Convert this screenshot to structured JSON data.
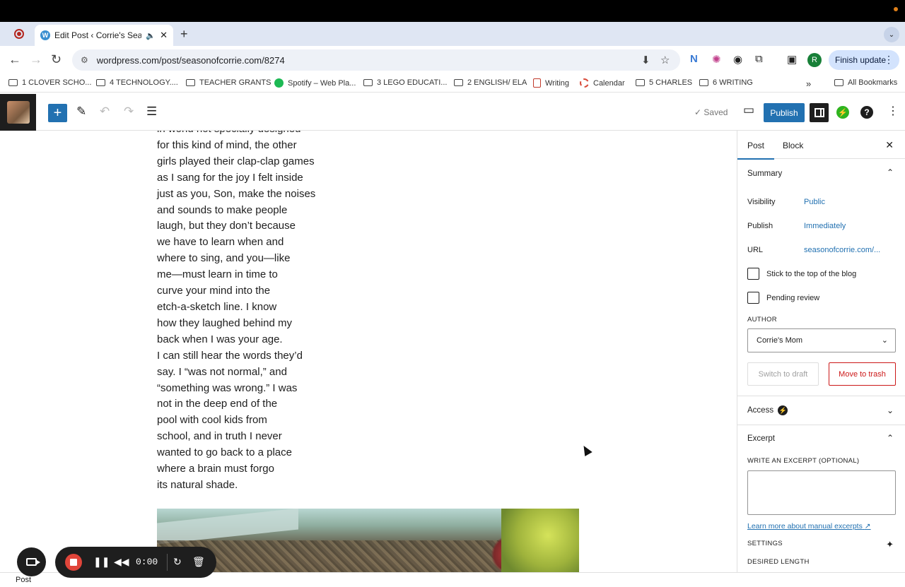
{
  "browser": {
    "tab_title": "Edit Post ‹ Corrie's Seaso",
    "url": "wordpress.com/post/seasonofcorrie.com/8274",
    "finish_update": "Finish update",
    "profile_initial": "R"
  },
  "bookmarks": [
    {
      "label": "1 CLOVER SCHO...",
      "icon": "folder-icon"
    },
    {
      "label": "4 TECHNOLOGY....",
      "icon": "folder-icon"
    },
    {
      "label": "TEACHER GRANTS",
      "icon": "folder-icon"
    },
    {
      "label": "Spotify – Web Pla...",
      "icon": "spotify-icon"
    },
    {
      "label": "3 LEGO EDUCATI...",
      "icon": "folder-icon"
    },
    {
      "label": "2 ENGLISH/ ELA",
      "icon": "folder-icon"
    },
    {
      "label": "Writing",
      "icon": "writing-icon"
    },
    {
      "label": "Calendar",
      "icon": "calendar-icon"
    },
    {
      "label": "5 CHARLES",
      "icon": "folder-icon"
    },
    {
      "label": "6 WRITING",
      "icon": "folder-icon"
    },
    {
      "label": "All Bookmarks",
      "icon": "folder-icon"
    }
  ],
  "editor_toolbar": {
    "saved": "✓ Saved",
    "publish": "Publish"
  },
  "poem_lines": [
    "in world not specially designed",
    "for this kind of mind, the other",
    "girls played their clap-clap games",
    "as I sang for the joy I felt inside",
    "just as you, Son, make the noises",
    "and sounds to make people",
    "laugh, but they don’t because",
    "we have to learn when and",
    "where to sing, and you—like",
    "me—must learn in time to",
    "curve your mind into the",
    "etch-a-sketch line.  I know",
    "how they laughed behind my",
    "back when I was your age.",
    "I can still hear the words they’d",
    "say. I “was not normal,” and",
    "“something was wrong.” I was",
    "not in the deep end of the",
    "pool with cool kids from",
    "school, and in truth I never",
    "wanted to go back to a place",
    "where a brain must forgo",
    "its natural shade."
  ],
  "sidebar": {
    "tab_post": "Post",
    "tab_block": "Block",
    "summary": "Summary",
    "visibility_label": "Visibility",
    "visibility_value": "Public",
    "publish_label": "Publish",
    "publish_value": "Immediately",
    "url_label": "URL",
    "url_value": "seasonofcorrie.com/...",
    "stick_label": "Stick to the top of the blog",
    "pending_label": "Pending review",
    "author_label": "AUTHOR",
    "author_value": "Corrie's Mom",
    "switch_draft": "Switch to draft",
    "move_trash": "Move to trash",
    "access": "Access",
    "excerpt": "Excerpt",
    "excerpt_label": "WRITE AN EXCERPT (OPTIONAL)",
    "excerpt_link": "Learn more about manual excerpts",
    "settings_label": "SETTINGS",
    "desired_length": "DESIRED LENGTH"
  },
  "recorder": {
    "time": "0:00"
  },
  "footer": {
    "breadcrumb": "Post"
  },
  "colors": {
    "wp_blue": "#2271b1",
    "trash_red": "#cc1818",
    "record_red": "#e0453a"
  }
}
